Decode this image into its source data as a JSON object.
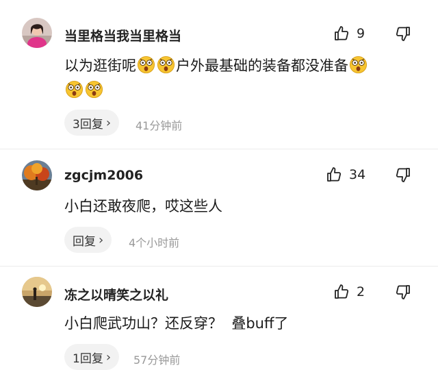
{
  "comments": [
    {
      "username": "当里格当我当里格当",
      "likes": "9",
      "text_part1": "以为逛街呢",
      "text_part2": "户外最基础的装备都没准备",
      "reply_label": "3回复",
      "time": "41分钟前",
      "avatar_icon": "woman-pink-outfit-avatar"
    },
    {
      "username": "zgcjm2006",
      "likes": "34",
      "text": "小白还敢夜爬，哎这些人",
      "reply_label": "回复",
      "time": "4个小时前",
      "avatar_icon": "autumn-tree-avatar"
    },
    {
      "username": "冻之以晴笑之以礼",
      "likes": "2",
      "text": "小白爬武功山？还反穿？  叠buff了",
      "reply_label": "1回复",
      "time": "57分钟前",
      "avatar_icon": "sunset-figure-avatar"
    }
  ],
  "icons": {
    "like": "thumbs-up-icon",
    "dislike": "thumbs-down-icon",
    "emoji": "shocked-face-emoji",
    "chevron": "chevron-right-icon"
  },
  "colors": {
    "secondary_text": "#999999",
    "pill_bg": "#f2f2f2",
    "emoji_yellow": "#f7c531"
  }
}
